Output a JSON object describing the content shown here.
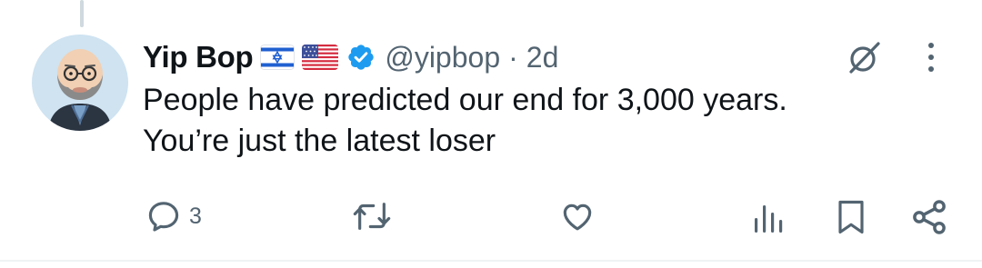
{
  "tweet": {
    "author_name": "Yip Bop",
    "flags": [
      "israel-flag-icon",
      "us-flag-icon"
    ],
    "verified": true,
    "handle": "@yipbop",
    "separator": "·",
    "time": "2d",
    "text_lines": [
      "People have predicted our end for 3,000 years.",
      "You’re just the latest loser"
    ]
  },
  "actions": {
    "reply_count": "3",
    "repost_count": "",
    "like_count": ""
  },
  "colors": {
    "text_primary": "#0f1419",
    "text_secondary": "#536471",
    "verified_blue": "#1d9bf0",
    "icon_gray": "#536471"
  }
}
